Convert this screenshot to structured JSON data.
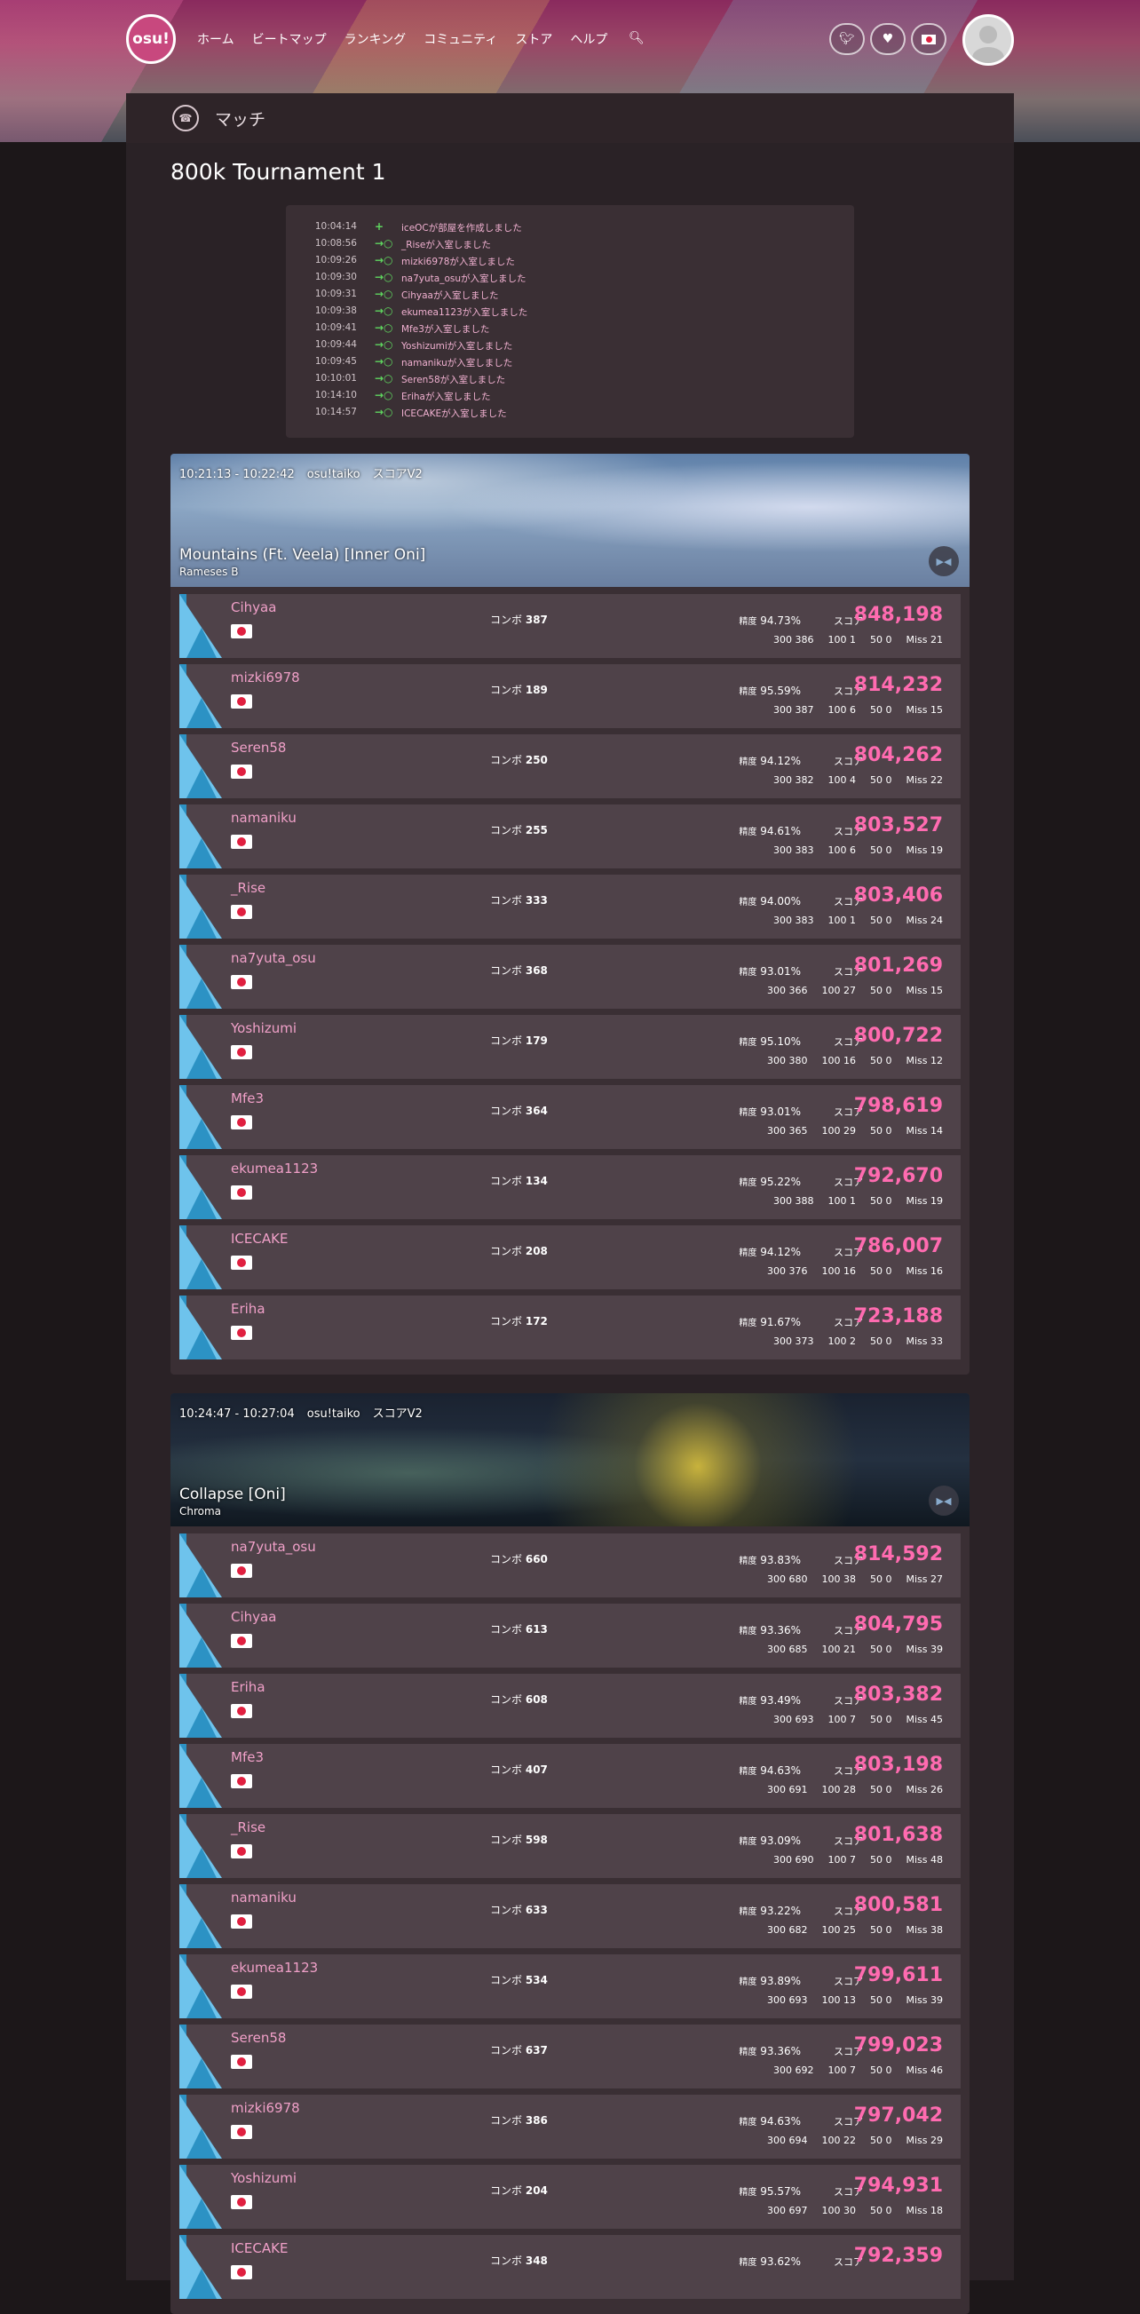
{
  "nav": {
    "logo": "osu!",
    "links": [
      "ホーム",
      "ビートマップ",
      "ランキング",
      "コミュニティ",
      "ストア",
      "ヘルプ"
    ]
  },
  "subheader": {
    "title": "マッチ"
  },
  "match": {
    "title": "800k Tournament 1"
  },
  "events": [
    {
      "time": "10:04:14",
      "icon": "plus",
      "text": "iceOCが部屋を作成しました"
    },
    {
      "time": "10:08:56",
      "icon": "join",
      "text": "_Riseが入室しました"
    },
    {
      "time": "10:09:26",
      "icon": "join",
      "text": "mizki6978が入室しました"
    },
    {
      "time": "10:09:30",
      "icon": "join",
      "text": "na7yuta_osuが入室しました"
    },
    {
      "time": "10:09:31",
      "icon": "join",
      "text": "Cihyaaが入室しました"
    },
    {
      "time": "10:09:38",
      "icon": "join",
      "text": "ekumea1123が入室しました"
    },
    {
      "time": "10:09:41",
      "icon": "join",
      "text": "Mfe3が入室しました"
    },
    {
      "time": "10:09:44",
      "icon": "join",
      "text": "Yoshizumiが入室しました"
    },
    {
      "time": "10:09:45",
      "icon": "join",
      "text": "namanikuが入室しました"
    },
    {
      "time": "10:10:01",
      "icon": "join",
      "text": "Seren58が入室しました"
    },
    {
      "time": "10:14:10",
      "icon": "join",
      "text": "Erihaが入室しました"
    },
    {
      "time": "10:14:57",
      "icon": "join",
      "text": "ICECAKEが入室しました"
    }
  ],
  "labels": {
    "combo": "コンボ",
    "accuracy": "精度",
    "score": "スコア",
    "h300": "300",
    "h100": "100",
    "h50": "50",
    "miss": "Miss"
  },
  "games": [
    {
      "time": "10:21:13 - 10:22:42",
      "mode": "osu!taiko",
      "scoring": "スコアV2",
      "song": "Mountains (Ft. Veela) [Inner Oni]",
      "artist": "Rameses B",
      "scores": [
        {
          "user": "Cihyaa",
          "combo": "387",
          "acc": "94.73%",
          "score": "848,198",
          "h300": "386",
          "h100": "1",
          "h50": "0",
          "miss": "21"
        },
        {
          "user": "mizki6978",
          "combo": "189",
          "acc": "95.59%",
          "score": "814,232",
          "h300": "387",
          "h100": "6",
          "h50": "0",
          "miss": "15"
        },
        {
          "user": "Seren58",
          "combo": "250",
          "acc": "94.12%",
          "score": "804,262",
          "h300": "382",
          "h100": "4",
          "h50": "0",
          "miss": "22"
        },
        {
          "user": "namaniku",
          "combo": "255",
          "acc": "94.61%",
          "score": "803,527",
          "h300": "383",
          "h100": "6",
          "h50": "0",
          "miss": "19"
        },
        {
          "user": "_Rise",
          "combo": "333",
          "acc": "94.00%",
          "score": "803,406",
          "h300": "383",
          "h100": "1",
          "h50": "0",
          "miss": "24"
        },
        {
          "user": "na7yuta_osu",
          "combo": "368",
          "acc": "93.01%",
          "score": "801,269",
          "h300": "366",
          "h100": "27",
          "h50": "0",
          "miss": "15"
        },
        {
          "user": "Yoshizumi",
          "combo": "179",
          "acc": "95.10%",
          "score": "800,722",
          "h300": "380",
          "h100": "16",
          "h50": "0",
          "miss": "12"
        },
        {
          "user": "Mfe3",
          "combo": "364",
          "acc": "93.01%",
          "score": "798,619",
          "h300": "365",
          "h100": "29",
          "h50": "0",
          "miss": "14"
        },
        {
          "user": "ekumea1123",
          "combo": "134",
          "acc": "95.22%",
          "score": "792,670",
          "h300": "388",
          "h100": "1",
          "h50": "0",
          "miss": "19"
        },
        {
          "user": "ICECAKE",
          "combo": "208",
          "acc": "94.12%",
          "score": "786,007",
          "h300": "376",
          "h100": "16",
          "h50": "0",
          "miss": "16"
        },
        {
          "user": "Eriha",
          "combo": "172",
          "acc": "91.67%",
          "score": "723,188",
          "h300": "373",
          "h100": "2",
          "h50": "0",
          "miss": "33"
        }
      ]
    },
    {
      "time": "10:24:47 - 10:27:04",
      "mode": "osu!taiko",
      "scoring": "スコアV2",
      "song": "Collapse [Oni]",
      "artist": "Chroma",
      "scores": [
        {
          "user": "na7yuta_osu",
          "combo": "660",
          "acc": "93.83%",
          "score": "814,592",
          "h300": "680",
          "h100": "38",
          "h50": "0",
          "miss": "27"
        },
        {
          "user": "Cihyaa",
          "combo": "613",
          "acc": "93.36%",
          "score": "804,795",
          "h300": "685",
          "h100": "21",
          "h50": "0",
          "miss": "39"
        },
        {
          "user": "Eriha",
          "combo": "608",
          "acc": "93.49%",
          "score": "803,382",
          "h300": "693",
          "h100": "7",
          "h50": "0",
          "miss": "45"
        },
        {
          "user": "Mfe3",
          "combo": "407",
          "acc": "94.63%",
          "score": "803,198",
          "h300": "691",
          "h100": "28",
          "h50": "0",
          "miss": "26"
        },
        {
          "user": "_Rise",
          "combo": "598",
          "acc": "93.09%",
          "score": "801,638",
          "h300": "690",
          "h100": "7",
          "h50": "0",
          "miss": "48"
        },
        {
          "user": "namaniku",
          "combo": "633",
          "acc": "93.22%",
          "score": "800,581",
          "h300": "682",
          "h100": "25",
          "h50": "0",
          "miss": "38"
        },
        {
          "user": "ekumea1123",
          "combo": "534",
          "acc": "93.89%",
          "score": "799,611",
          "h300": "693",
          "h100": "13",
          "h50": "0",
          "miss": "39"
        },
        {
          "user": "Seren58",
          "combo": "637",
          "acc": "93.36%",
          "score": "799,023",
          "h300": "692",
          "h100": "7",
          "h50": "0",
          "miss": "46"
        },
        {
          "user": "mizki6978",
          "combo": "386",
          "acc": "94.63%",
          "score": "797,042",
          "h300": "694",
          "h100": "22",
          "h50": "0",
          "miss": "29"
        },
        {
          "user": "Yoshizumi",
          "combo": "204",
          "acc": "95.57%",
          "score": "794,931",
          "h300": "697",
          "h100": "30",
          "h50": "0",
          "miss": "18"
        },
        {
          "user": "ICECAKE",
          "combo": "348",
          "acc": "93.62%",
          "score": "792,359",
          "h300": "",
          "h100": "",
          "h50": "",
          "miss": ""
        }
      ]
    }
  ],
  "colors": {
    "accent": "#ff6bb0",
    "username": "#f0a0c8",
    "row_bg": "#4f4249",
    "join_icon": "#5fd65f"
  }
}
